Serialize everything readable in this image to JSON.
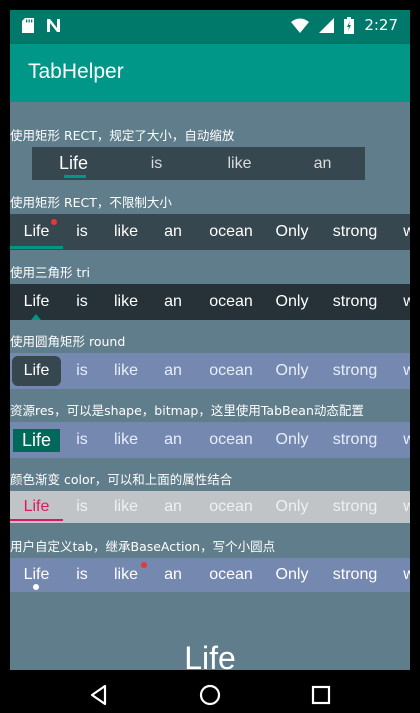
{
  "status": {
    "time": "2:27",
    "icons": [
      "sd-card-icon",
      "n-icon",
      "wifi-icon",
      "signal-icon",
      "battery-icon"
    ]
  },
  "app": {
    "title": "TabHelper"
  },
  "tabs": [
    "Life",
    "is",
    "like",
    "an",
    "ocean",
    "Only",
    "strong",
    "w"
  ],
  "sections": [
    {
      "title": "使用矩形 RECT，规定了大小，自动缩放",
      "tabs": [
        "Life",
        "is",
        "like",
        "an"
      ]
    },
    {
      "title": "使用矩形 RECT，不限制大小"
    },
    {
      "title": "使用三角形 tri"
    },
    {
      "title": "使用圆角矩形 round"
    },
    {
      "title": "资源res，可以是shape，bitmap，这里使用TabBean动态配置"
    },
    {
      "title": "颜色渐变 color，可以和上面的属性结合"
    },
    {
      "title": "用户自定义tab，继承BaseAction，写个小圆点"
    }
  ],
  "pager_label": "Life",
  "colors": {
    "status_bar": "#00796b",
    "app_bar": "#009688",
    "background": "#607d8b",
    "accent_red": "#e53935",
    "gradient_pink": "#d81b60"
  }
}
